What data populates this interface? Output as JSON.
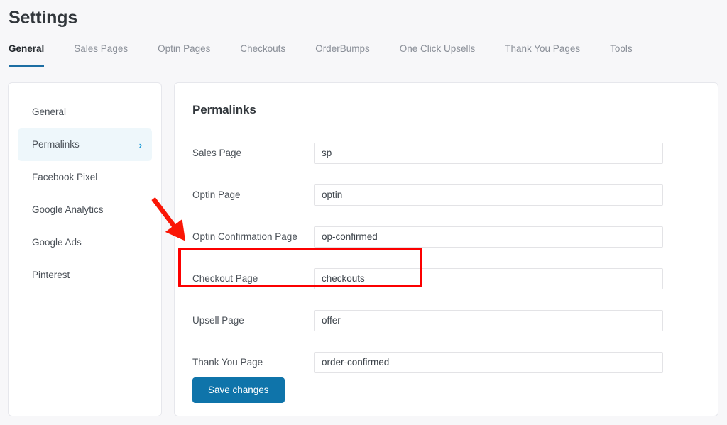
{
  "page": {
    "title": "Settings"
  },
  "tabs": [
    {
      "label": "General",
      "active": true
    },
    {
      "label": "Sales Pages",
      "active": false
    },
    {
      "label": "Optin Pages",
      "active": false
    },
    {
      "label": "Checkouts",
      "active": false
    },
    {
      "label": "OrderBumps",
      "active": false
    },
    {
      "label": "One Click Upsells",
      "active": false
    },
    {
      "label": "Thank You Pages",
      "active": false
    },
    {
      "label": "Tools",
      "active": false
    }
  ],
  "sidebar": {
    "items": [
      {
        "label": "General",
        "active": false,
        "chevron": ""
      },
      {
        "label": "Permalinks",
        "active": true,
        "chevron": "›"
      },
      {
        "label": "Facebook Pixel",
        "active": false,
        "chevron": ""
      },
      {
        "label": "Google Analytics",
        "active": false,
        "chevron": ""
      },
      {
        "label": "Google Ads",
        "active": false,
        "chevron": ""
      },
      {
        "label": "Pinterest",
        "active": false,
        "chevron": ""
      }
    ]
  },
  "main": {
    "panel_title": "Permalinks",
    "fields": [
      {
        "label": "Sales Page",
        "value": "sp"
      },
      {
        "label": "Optin Page",
        "value": "optin"
      },
      {
        "label": "Optin Confirmation Page",
        "value": "op-confirmed"
      },
      {
        "label": "Checkout Page",
        "value": "checkouts"
      },
      {
        "label": "Upsell Page",
        "value": "offer"
      },
      {
        "label": "Thank You Page",
        "value": "order-confirmed"
      }
    ],
    "save_label": "Save changes"
  },
  "annotations": {
    "highlight_color": "#fc0000",
    "highlight_target": "Checkout Page",
    "arrow_color": "#fa1606"
  },
  "colors": {
    "accent_blue": "#1d6ea3",
    "button_blue": "#0f74aa",
    "active_item_bg": "#eef7fb",
    "chevron_blue": "#1e9bd7"
  }
}
